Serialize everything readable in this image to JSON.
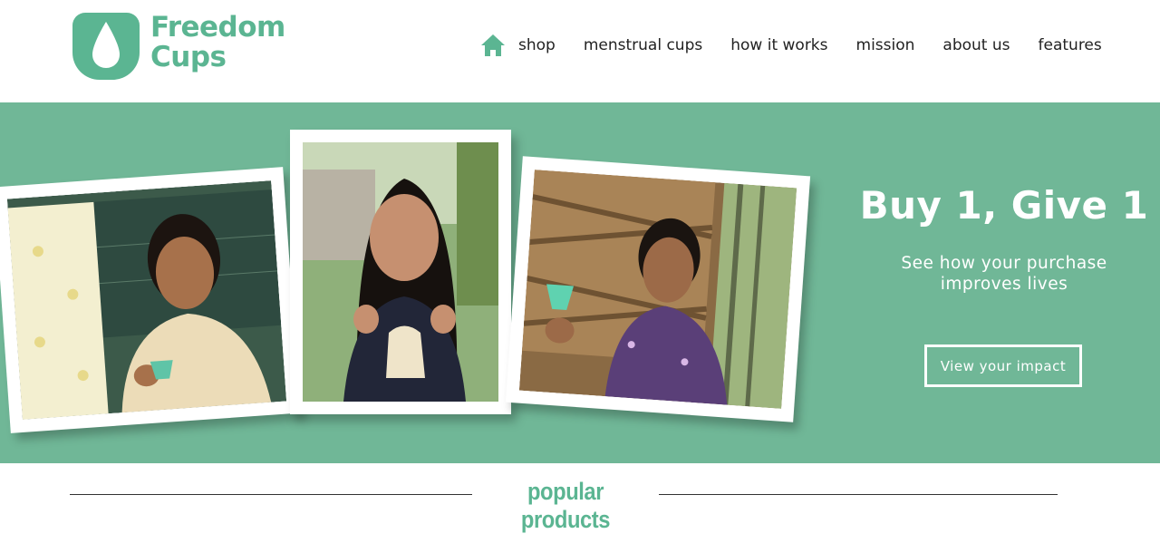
{
  "brand": {
    "line1": "Freedom",
    "line2": "Cups",
    "color": "#5bb592"
  },
  "nav": {
    "home_icon": "house-icon",
    "items": [
      {
        "label": "shop"
      },
      {
        "label": "menstrual cups"
      },
      {
        "label": "how it works"
      },
      {
        "label": "mission"
      },
      {
        "label": "about us"
      },
      {
        "label": "features"
      }
    ]
  },
  "hero": {
    "background": "#70b797",
    "title": "Buy 1, Give 1",
    "subtitle_line1": "See how your purchase",
    "subtitle_line2": "improves lives",
    "button_label": "View your impact",
    "photos": [
      {
        "subject": "woman-holding-menstrual-cup-at-chalkboard"
      },
      {
        "subject": "young-woman-holding-cloth-pouch"
      },
      {
        "subject": "woman-holding-green-menstrual-cup"
      }
    ]
  },
  "section": {
    "title": "popular products"
  }
}
